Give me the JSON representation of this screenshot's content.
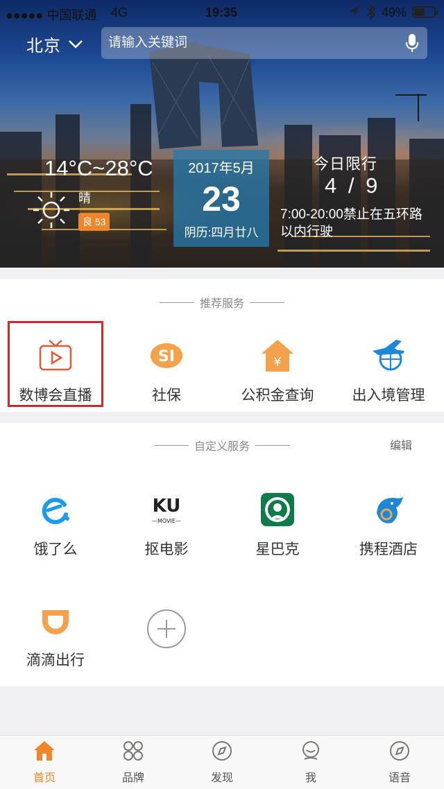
{
  "status_bar": {
    "carrier": "●●●●● 中国联通",
    "network": "4G",
    "time": "19:35",
    "battery": "49%"
  },
  "header": {
    "city": "北京",
    "search_placeholder": "请输入关键词"
  },
  "weather": {
    "temp_range": "14°C~28°C",
    "condition": "晴",
    "aqi": "良 53"
  },
  "date": {
    "year_month": "2017年5月",
    "day": "23",
    "lunar": "阴历:四月廿八"
  },
  "restriction": {
    "title": "今日限行",
    "numbers": "4 / 9",
    "rule": "7:00-20:00禁止在五环路以内行驶"
  },
  "recommended": {
    "title": "推荐服务",
    "items": [
      {
        "label": "数博会直播",
        "icon": "tv-live-icon"
      },
      {
        "label": "社保",
        "icon": "social-security-icon"
      },
      {
        "label": "公积金查询",
        "icon": "housing-fund-icon"
      },
      {
        "label": "出入境管理",
        "icon": "plane-globe-icon"
      }
    ]
  },
  "custom": {
    "title": "自定义服务",
    "edit": "编辑",
    "items": [
      {
        "label": "饿了么",
        "icon": "eleme-icon"
      },
      {
        "label": "抠电影",
        "icon": "kou-movie-icon"
      },
      {
        "label": "星巴克",
        "icon": "starbucks-icon"
      },
      {
        "label": "携程酒店",
        "icon": "ctrip-dolphin-icon"
      },
      {
        "label": "滴滴出行",
        "icon": "didi-icon"
      },
      {
        "label": "",
        "icon": "add-icon"
      }
    ]
  },
  "nav": {
    "items": [
      {
        "label": "首页",
        "icon": "home-icon",
        "active": true
      },
      {
        "label": "品牌",
        "icon": "brand-grid-icon"
      },
      {
        "label": "发现",
        "icon": "compass-icon"
      },
      {
        "label": "我",
        "icon": "profile-icon"
      },
      {
        "label": "语音",
        "icon": "voice-compass-icon"
      }
    ]
  },
  "colors": {
    "accent": "#f0862a",
    "highlight_border": "#d0282a",
    "date_box": "#2878aa"
  }
}
